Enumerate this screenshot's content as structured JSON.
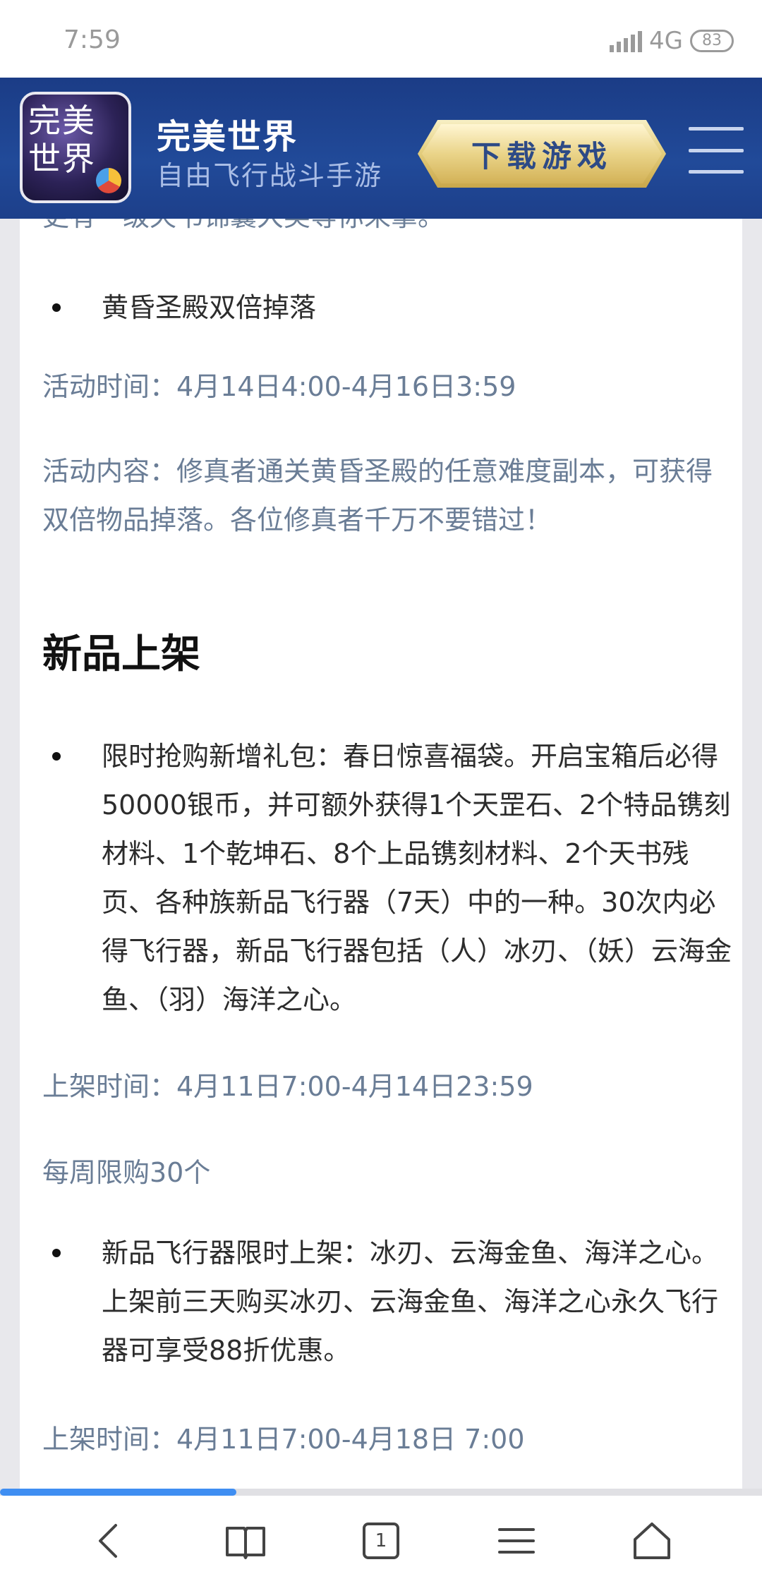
{
  "status_bar": {
    "time": "7:59",
    "network": "4G",
    "battery": "83"
  },
  "header": {
    "logo_text": "完美世界",
    "title": "完美世界",
    "subtitle": "自由飞行战斗手游",
    "download_label": "下载游戏"
  },
  "article": {
    "clipped_line": "更有一级天书锦囊大奖等你来拿。",
    "bullet1": "黄昏圣殿双倍掉落",
    "time1": "活动时间：4月14日4:00-4月16日3:59",
    "content1": "活动内容：修真者通关黄昏圣殿的任意难度副本，可获得双倍物品掉落。各位修真者千万不要错过！",
    "heading": "新品上架",
    "bullet2": "限时抢购新增礼包：春日惊喜福袋。开启宝箱后必得50000银币，并可额外获得1个天罡石、2个特品镌刻材料、1个乾坤石、8个上品镌刻材料、2个天书残页、各种族新品飞行器（7天）中的一种。30次内必得飞行器，新品飞行器包括（人）冰刃、（妖）云海金鱼、（羽）海洋之心。",
    "time2": "上架时间：4月11日7:00-4月14日23:59",
    "limit": "每周限购30个",
    "bullet3": "新品飞行器限时上架：冰刃、云海金鱼、海洋之心。上架前三天购买冰刃、云海金鱼、海洋之心永久飞行器可享受88折优惠。",
    "time3": "上架时间：4月11日7:00-4月18日 7:00"
  },
  "page_progress": 0.31,
  "bottom_nav": {
    "tab_count": "1"
  }
}
